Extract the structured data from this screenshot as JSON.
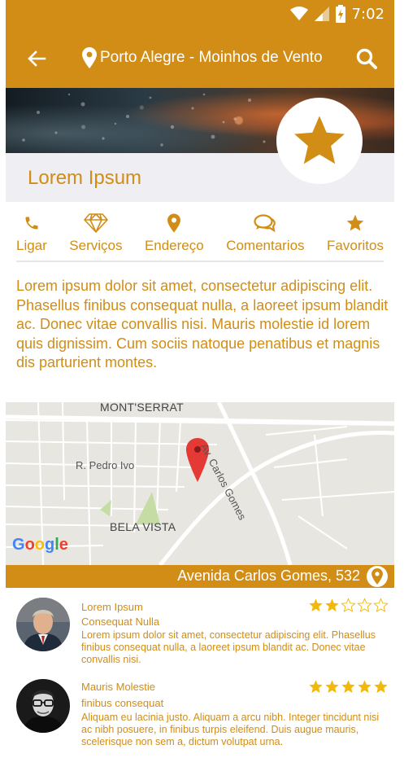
{
  "status_bar": {
    "time": "7:02"
  },
  "toolbar": {
    "location": "Porto Alegre - Moinhos de Vento"
  },
  "place": {
    "name": "Lorem Ipsum"
  },
  "actions": [
    {
      "label": "Ligar",
      "icon": "phone-icon"
    },
    {
      "label": "Serviços",
      "icon": "diamond-icon"
    },
    {
      "label": "Endereço",
      "icon": "map-marker-icon"
    },
    {
      "label": "Comentarios",
      "icon": "comments-icon"
    },
    {
      "label": "Favoritos",
      "icon": "star-icon"
    }
  ],
  "description": "Lorem ipsum dolor sit amet, consectetur adipiscing elit. Phasellus finibus consequat nulla, a laoreet ipsum blandit ac. Donec vitae convallis nisi. Mauris molestie id lorem quis dignissim. Cum sociis natoque penatibus et magnis dis parturient montes.",
  "map": {
    "labels": {
      "montserrat": "MONT'SERRAT",
      "pedro_ivo": "R. Pedro Ivo",
      "bela_vista": "BELA VISTA",
      "carlos_gomes": "Av. Carlos Gomes"
    },
    "google": "Google"
  },
  "address": "Avenida Carlos Gomes, 532",
  "reviews": [
    {
      "author": "Lorem Ipsum",
      "title": "Consequat Nulla",
      "text": "Lorem ipsum dolor sit amet, consectetur adipiscing elit. Phasellus finibus consequat nulla, a laoreet ipsum blandit ac. Donec vitae convallis nisi.",
      "rating": 2,
      "max_rating": 5
    },
    {
      "author": "Mauris Molestie",
      "title": "finibus consequat",
      "text": "Aliquam eu lacinia justo. Aliquam a arcu nibh. Integer tincidunt nisi ac nibh posuere, in finibus turpis eleifend. Duis augue mauris, scelerisque non sem a, dictum volutpat urna.",
      "rating": 5,
      "max_rating": 5
    }
  ],
  "colors": {
    "accent": "#D18D16",
    "star": "#F2B90C",
    "band": "#EEEEF3",
    "map_pin": "#E53935"
  }
}
